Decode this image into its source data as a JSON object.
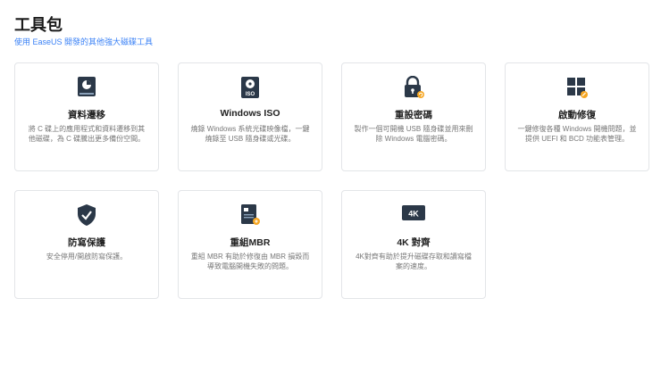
{
  "header": {
    "title": "工具包",
    "subtitle": "使用 EaseUS 開發的其他強大磁碟工具"
  },
  "tools": [
    {
      "name": "資料遷移",
      "desc": "將 C 碟上的應用程式和資料遷移到其他磁碟，為 C 碟騰出更多備份空間。",
      "icon": "migration-icon"
    },
    {
      "name": "Windows ISO",
      "desc": "燒錄 Windows 系統光碟映像檔，一鍵燒錄至 USB 隨身碟或光碟。",
      "icon": "iso-icon"
    },
    {
      "name": "重設密碼",
      "desc": "製作一個可開機 USB 隨身碟並用來刪除 Windows 電腦密碼。",
      "icon": "lock-icon"
    },
    {
      "name": "啟動修復",
      "desc": "一鍵修復各種 Windows 開機問題，並提供 UEFI 和 BCD 功能表管理。",
      "icon": "windows-repair-icon"
    },
    {
      "name": "防寫保護",
      "desc": "安全停用/開啟防寫保護。",
      "icon": "shield-icon"
    },
    {
      "name": "重組MBR",
      "desc": "重組 MBR 有助於修復由 MBR 損毀而導致電腦開機失敗的問題。",
      "icon": "mbr-icon"
    },
    {
      "name": "4K 對齊",
      "desc": "4K對齊有助於提升磁碟存取和讀寫檔案的速度。",
      "icon": "4k-icon"
    }
  ],
  "colors": {
    "accent": "#3b82f6",
    "icon_dark": "#2b3848",
    "badge": "#f5a623"
  }
}
